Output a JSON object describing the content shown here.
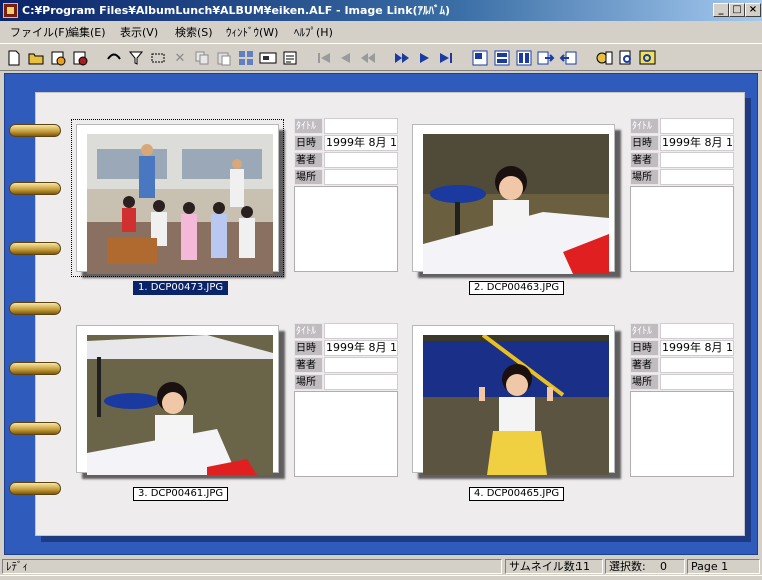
{
  "window": {
    "title": "C:¥Program Files¥AlbumLunch¥ALBUM¥eiken.ALF - Image Link(ｱﾙﾊﾞﾑ)",
    "minimize": "_",
    "maximize": "□",
    "close": "×"
  },
  "menu": [
    "ファイル(F)",
    "編集(E)",
    "表示(V)",
    "検索(S)",
    "ｳｨﾝﾄﾞｳ(W)",
    "ﾍﾙﾌﾟ(H)"
  ],
  "toolbar": {
    "icons": [
      "new-icon",
      "open-icon",
      "close-file-icon",
      "save-icon",
      "cut-icon",
      "filter-icon",
      "select-all-icon",
      "delete-icon",
      "copy-icon",
      "paste-icon",
      "thumbnail-icon",
      "slideshow-icon",
      "properties-icon",
      "first-page-icon",
      "prev-icon",
      "prev-fast-icon",
      "next-fast-icon",
      "next-icon",
      "last-page-icon",
      "layout-1-icon",
      "layout-2-icon",
      "layout-3-icon",
      "export-icon",
      "import-icon",
      "settings-icon",
      "search-icon",
      "zoom-icon"
    ]
  },
  "info_labels": {
    "title": "ﾀｲﾄﾙ",
    "date": "日時",
    "author": "著者",
    "place": "場所"
  },
  "items": [
    {
      "caption": "1. DCP00473.JPG",
      "date": "1999年  8月 1",
      "selected": true
    },
    {
      "caption": "2. DCP00463.JPG",
      "date": "1999年  8月 1",
      "selected": false
    },
    {
      "caption": "3. DCP00461.JPG",
      "date": "1999年  8月 1",
      "selected": false
    },
    {
      "caption": "4. DCP00465.JPG",
      "date": "1999年  8月 1",
      "selected": false
    }
  ],
  "status": {
    "ready": "ﾚﾃﾞｨ",
    "thumbnail_count_label": "サムネイル数:",
    "thumbnail_count": "11",
    "selection_label": "選択数:",
    "selection_count": "0",
    "page": "Page 1"
  },
  "colors": {
    "album_background": "#2f5bbd",
    "page": "#efecee",
    "selection": "#0a246a",
    "titlebar": "#0a246a"
  }
}
